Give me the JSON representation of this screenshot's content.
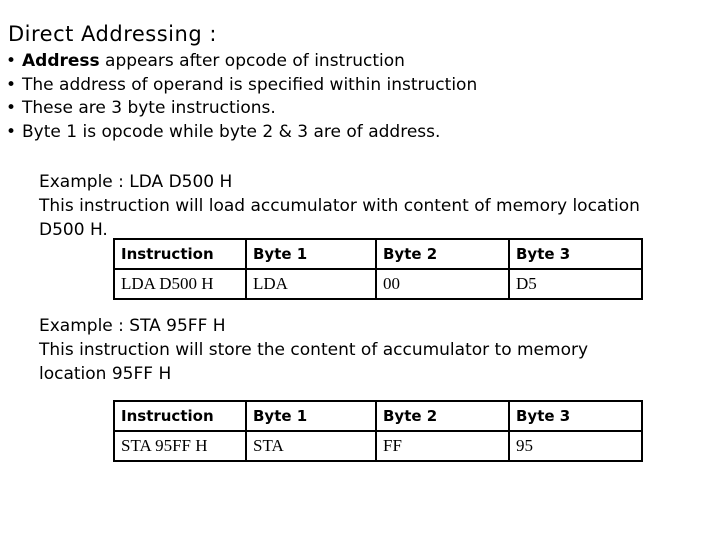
{
  "title": "Direct Addressing :",
  "bullets": [
    {
      "bold": "Address",
      "text": " appears after opcode of instruction"
    },
    {
      "bold": "",
      "text": "The address of operand is specified within instruction"
    },
    {
      "bold": "",
      "text": "These are 3 byte instructions."
    },
    {
      "bold": "",
      "text": "Byte 1 is opcode while byte 2 & 3 are of address."
    }
  ],
  "bullet_glyph": "•",
  "example1": {
    "heading": "Example : LDA D500 H",
    "line1": "This instruction will load accumulator with content of memory location",
    "line2": "D500 H.",
    "table": {
      "headers": [
        "Instruction",
        "Byte 1",
        "Byte 2",
        "Byte 3"
      ],
      "row": [
        "LDA D500 H",
        "LDA",
        "00",
        "D5"
      ]
    }
  },
  "example2": {
    "heading": "Example : STA 95FF H",
    "line1": "This instruction will store the content of accumulator to memory",
    "line2": "location 95FF H",
    "table": {
      "headers": [
        "Instruction",
        "Byte 1",
        "Byte 2",
        "Byte 3"
      ],
      "row": [
        "STA 95FF H",
        "STA",
        "FF",
        "95"
      ]
    }
  }
}
